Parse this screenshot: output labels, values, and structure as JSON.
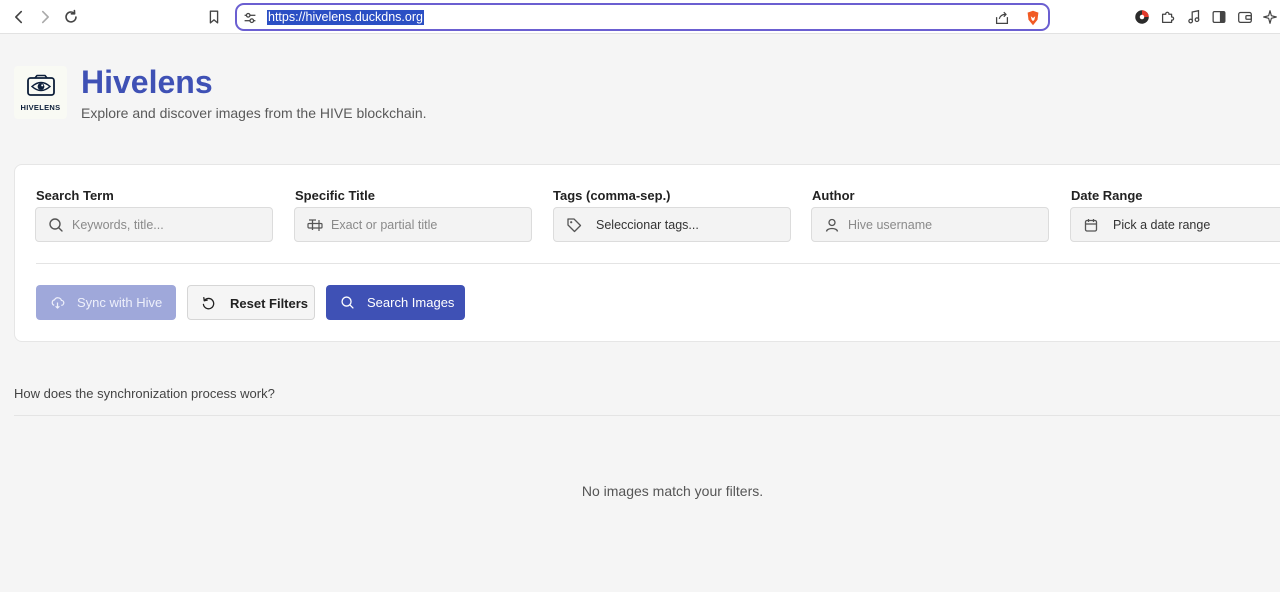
{
  "browser": {
    "url": "https://hivelens.duckdns.org",
    "icons": [
      "back-arrow-icon",
      "forward-arrow-icon",
      "reload-icon",
      "bookmark-icon",
      "site-settings-icon",
      "share-icon",
      "brave-shield-icon",
      "profile-icon",
      "extensions-icon",
      "media-icon",
      "sidebar-icon",
      "wallet-icon",
      "leo-ai-icon"
    ]
  },
  "header": {
    "logo_text": "HIVELENS",
    "title": "Hivelens",
    "subtitle": "Explore and discover images from the HIVE blockchain."
  },
  "filters": {
    "search_term": {
      "label": "Search Term",
      "placeholder": "Keywords, title..."
    },
    "specific_title": {
      "label": "Specific Title",
      "placeholder": "Exact or partial title"
    },
    "tags": {
      "label": "Tags (comma-sep.)",
      "placeholder": "Seleccionar tags..."
    },
    "author": {
      "label": "Author",
      "placeholder": "Hive username"
    },
    "date_range": {
      "label": "Date Range",
      "placeholder": "Pick a date range"
    }
  },
  "actions": {
    "sync_label": "Sync with Hive",
    "reset_label": "Reset Filters",
    "search_label": "Search Images"
  },
  "faq": {
    "question": "How does the synchronization process work?"
  },
  "results": {
    "empty_message": "No images match your filters."
  },
  "colors": {
    "accent": "#3f51b5",
    "accent_disabled": "#9fa8da",
    "url_highlight": "#2b4fc4",
    "urlbar_border": "#6b5fd1"
  }
}
